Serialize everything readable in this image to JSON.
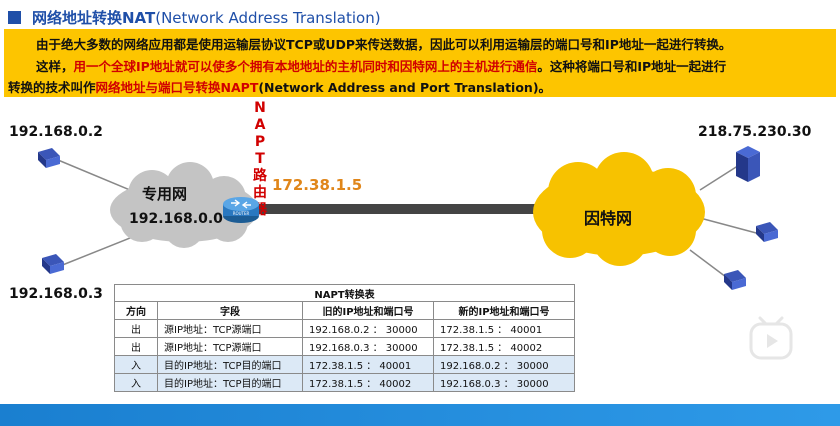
{
  "title": {
    "cn": "网络地址转换NAT",
    "en": "(Network Address Translation)"
  },
  "note": {
    "line1": "由于绝大多数的网络应用都是使用运输层协议TCP或UDP来传送数据，因此可以利用运输层的端口号和IP地址一起进行转换。",
    "line2_a": "这样，",
    "line2_red": "用一个全球IP地址就可以使多个拥有本地地址的主机同时和因特网上的主机进行通信",
    "line2_b": "。这种将端口号和IP地址一起进行",
    "line3_a": "转换的技术叫作",
    "line3_red": "网络地址与端口号转换NAPT",
    "line3_b": "(Network Address and Port Translation)。"
  },
  "hosts": {
    "h1": "192.168.0.2",
    "h2": "192.168.0.3",
    "server": "218.75.230.30"
  },
  "private_net": {
    "name": "专用网",
    "addr": "192.168.0.0"
  },
  "router": {
    "label": [
      "N",
      "A",
      "P",
      "T",
      "路",
      "由",
      "器"
    ],
    "device_text": "ROUTER",
    "public_ip": "172.38.1.5"
  },
  "internet": {
    "name": "因特网"
  },
  "table": {
    "caption": "NAPT转换表",
    "headers": [
      "方向",
      "字段",
      "旧的IP地址和端口号",
      "新的IP地址和端口号"
    ],
    "rows": [
      [
        "出",
        "源IP地址：TCP源端口",
        "192.168.0.2 ： 30000",
        "172.38.1.5 ： 40001"
      ],
      [
        "出",
        "源IP地址：TCP源端口",
        "192.168.0.3 ： 30000",
        "172.38.1.5 ： 40002"
      ],
      [
        "入",
        "目的IP地址：TCP目的端口",
        "172.38.1.5 ： 40001",
        "192.168.0.2 ： 30000"
      ],
      [
        "入",
        "目的IP地址：TCP目的端口",
        "172.38.1.5 ： 40002",
        "192.168.0.3 ： 30000"
      ]
    ]
  },
  "colors": {
    "title": "#1f4fa8",
    "note_bg": "#fdc500",
    "emphasis": "#d10000",
    "public_ip": "#e0861a",
    "cloud_private": "#c4c4c4",
    "cloud_internet": "#f7c200"
  },
  "icons": {
    "host": "computer-icon",
    "router": "router-icon",
    "server": "server-icon",
    "play": "play-icon"
  }
}
